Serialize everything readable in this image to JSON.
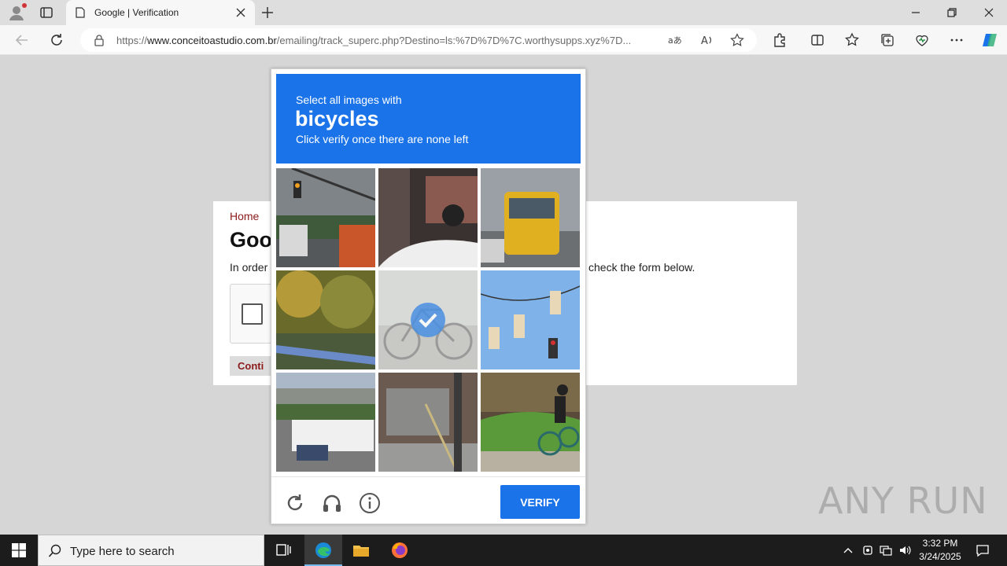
{
  "browser": {
    "tab_title": "Google | Verification",
    "url_prefix": "https://",
    "url_host": "www.conceitoastudio.com.br",
    "url_path": "/emailing/track_superc.php?Destino=ls:%7D%7D%7C.worthysupps.xyz%7D..."
  },
  "page": {
    "breadcrumb": "Home",
    "title_fragment": "Goo",
    "text_left": "In order",
    "text_right": "check the form below.",
    "continue_label": "Conti"
  },
  "challenge": {
    "prompt": "Select all images with",
    "target": "bicycles",
    "instruction": "Click verify once there are none left",
    "tiles": [
      {
        "subject": "traffic light and truck",
        "selected": false
      },
      {
        "subject": "car and motorcycle",
        "selected": false
      },
      {
        "subject": "bus",
        "selected": false
      },
      {
        "subject": "trees and guardrail",
        "selected": false
      },
      {
        "subject": "bicycle",
        "selected": true
      },
      {
        "subject": "traffic lights",
        "selected": false
      },
      {
        "subject": "highway truck",
        "selected": false
      },
      {
        "subject": "building entrance",
        "selected": false
      },
      {
        "subject": "cyclist",
        "selected": false
      }
    ],
    "verify_label": "VERIFY"
  },
  "watermark": "ANY RUN",
  "taskbar": {
    "search_placeholder": "Type here to search",
    "time": "3:32 PM",
    "date": "3/24/2025"
  },
  "colors": {
    "accent": "#1a73e8",
    "breadcrumb": "#8b1b1b"
  }
}
